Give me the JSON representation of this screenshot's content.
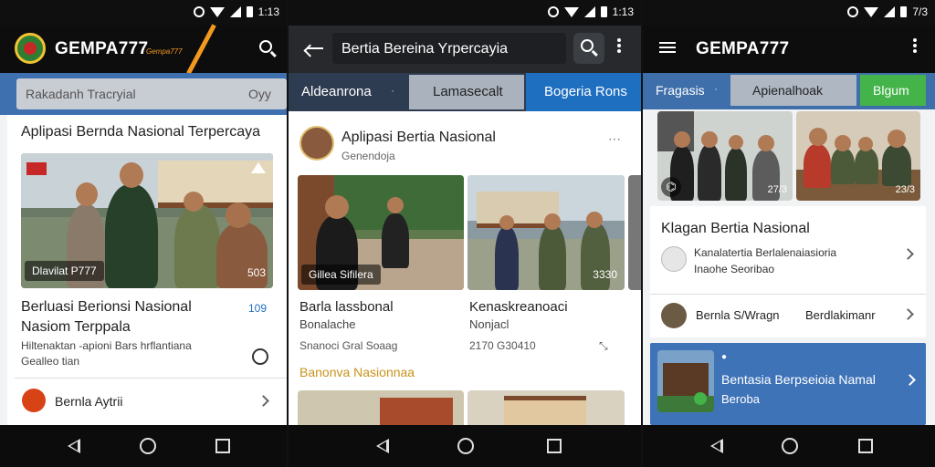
{
  "status": {
    "left_time": "1:13",
    "mid_time": "1:13",
    "right_time": "7/3"
  },
  "phone1": {
    "app_title": "GEMPA777",
    "app_subtitle": "Gempa777",
    "search": {
      "placeholder": "Rakadanh Tracryial",
      "right_hint": "Oyy"
    },
    "section_title": "Aplipasi Bernda Nasional Terpercaya",
    "hero_caption": "Dlavilat P777",
    "hero_count": "503",
    "article_title_1": "Berluasi Berionsi Nasional",
    "article_title_2": "Nasiom Terppala",
    "article_meta_1": "Hiltenaktan -apioni Bars hrflantiana",
    "article_meta_2": "Gealleo tian",
    "article_badge": "109",
    "footer_item": "Bernla Aytrii"
  },
  "phone2": {
    "search_value": "Bertia Bereina Yrpercayia",
    "tabs": [
      {
        "label": "Aldeanrona"
      },
      {
        "label": "Lamasecalt"
      },
      {
        "label": "Bogeria Rons"
      }
    ],
    "channel_title": "Aplipasi Bertia Nasional",
    "channel_sub": "Genendoja",
    "card1_chip": "Gillea Sifilera",
    "card1_title_1": "Barla lassbonal",
    "card1_title_2": "Bonalache",
    "card1_meta": "Snanoci Gral Soaag",
    "card2_chip": "3330",
    "card2_title_1": "Kenaskreanoaci",
    "card2_title_2": "Nonjacl",
    "card2_meta": "2170 G30410",
    "section_link": "Banonva Nasionnaa"
  },
  "phone3": {
    "app_title": "GEMPA777",
    "tabs": [
      {
        "label": "Fragasis"
      },
      {
        "label": "Apienalhoak"
      },
      {
        "label": "Blgum"
      }
    ],
    "photo1_count": "27/3",
    "photo2_count": "23/3",
    "section_title": "Klagan Bertia Nasional",
    "item1_text_1": "Kanalatertia Berlalenaiasioria",
    "item1_text_2": "Inaohe Seoribao",
    "item2_text": "Bernla S/Wragn",
    "item2_right": "Berdlakimanr",
    "promo_title": "Bentasia Berpseioia Namal",
    "promo_sub": "Beroba"
  },
  "colors": {
    "accent_orange": "#f39a1e",
    "tab_blue": "#1f6fc1",
    "tab_green": "#43b34a",
    "link_gold": "#c9921c"
  }
}
